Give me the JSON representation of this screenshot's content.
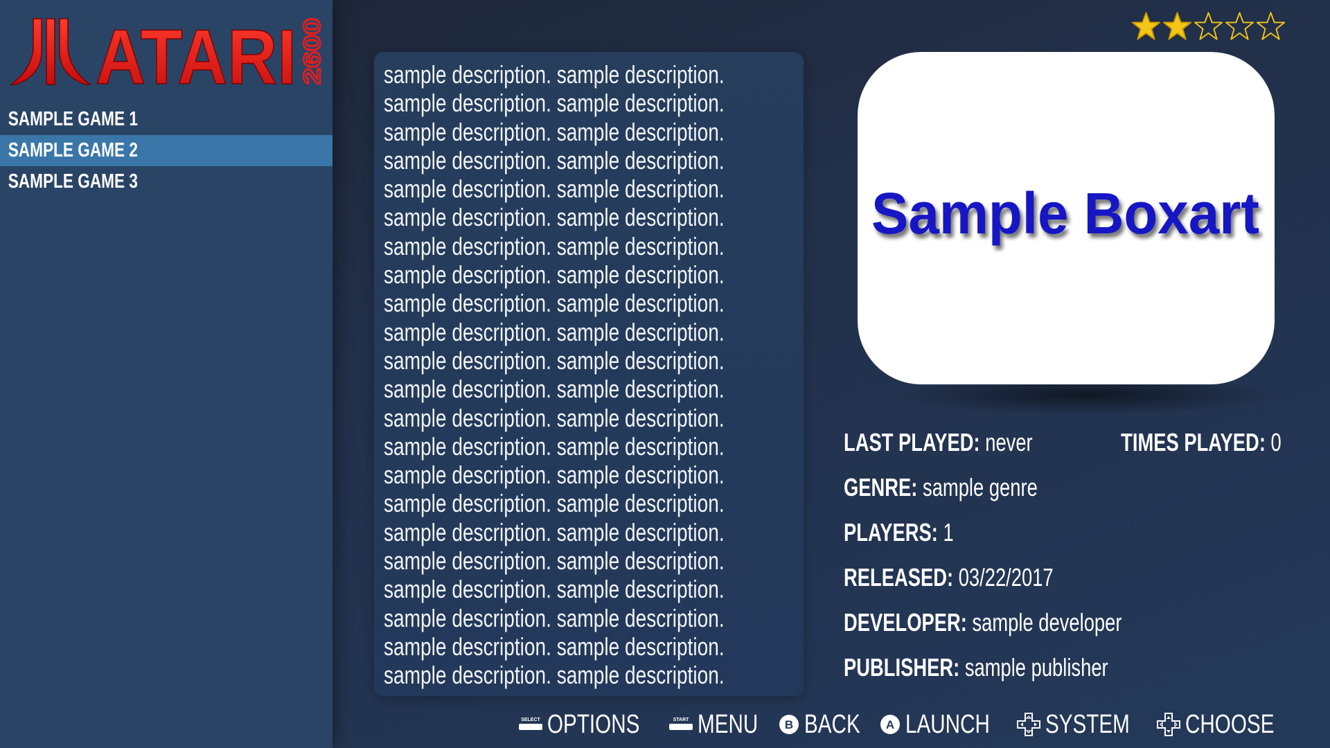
{
  "system": {
    "logo_text": "ATARI",
    "logo_subtext": "2600"
  },
  "games": [
    {
      "label": "SAMPLE GAME 1",
      "selected": false
    },
    {
      "label": "SAMPLE GAME 2",
      "selected": true
    },
    {
      "label": "SAMPLE GAME 3",
      "selected": false
    }
  ],
  "description": "sample description. sample description.\nsample description. sample description.\nsample description. sample description.\nsample description. sample description.\nsample description. sample description.\nsample description. sample description.\nsample description. sample description.\nsample description. sample description.\nsample description. sample description.\nsample description. sample description.\nsample description. sample description.\nsample description. sample description.\nsample description. sample description.\nsample description. sample description.\nsample description. sample description.\nsample description. sample description.\nsample description. sample description.\nsample description. sample description.\nsample description. sample description.\nsample description. sample description.\nsample description. sample description.\nsample description. sample description.",
  "rating": {
    "filled": 2,
    "total": 5,
    "color": "#f5c518"
  },
  "boxart": {
    "text": "Sample Boxart",
    "color": "#1010c8"
  },
  "metadata": {
    "last_played": {
      "label": "LAST PLAYED:",
      "value": "never"
    },
    "times_played": {
      "label": "TIMES PLAYED:",
      "value": "0"
    },
    "genre": {
      "label": "GENRE:",
      "value": "sample genre"
    },
    "players": {
      "label": "PLAYERS:",
      "value": "1"
    },
    "released": {
      "label": "RELEASED:",
      "value": "03/22/2017"
    },
    "developer": {
      "label": "DEVELOPER:",
      "value": "sample developer"
    },
    "publisher": {
      "label": "PUBLISHER:",
      "value": "sample publisher"
    }
  },
  "help": [
    {
      "icon": "select-button-icon",
      "icon_text": "SELECT",
      "label": "OPTIONS"
    },
    {
      "icon": "start-button-icon",
      "icon_text": "START",
      "label": "MENU"
    },
    {
      "icon": "b-button-icon",
      "icon_text": "B",
      "label": "BACK"
    },
    {
      "icon": "a-button-icon",
      "icon_text": "A",
      "label": "LAUNCH"
    },
    {
      "icon": "dpad-left-right-icon",
      "icon_text": "",
      "label": "SYSTEM"
    },
    {
      "icon": "dpad-up-down-icon",
      "icon_text": "",
      "label": "CHOOSE"
    }
  ],
  "colors": {
    "sidebar_bg": "#2a4466",
    "selected_bg": "#3a76a8",
    "logo_red": "#e81c1c",
    "background": "#22304a"
  }
}
